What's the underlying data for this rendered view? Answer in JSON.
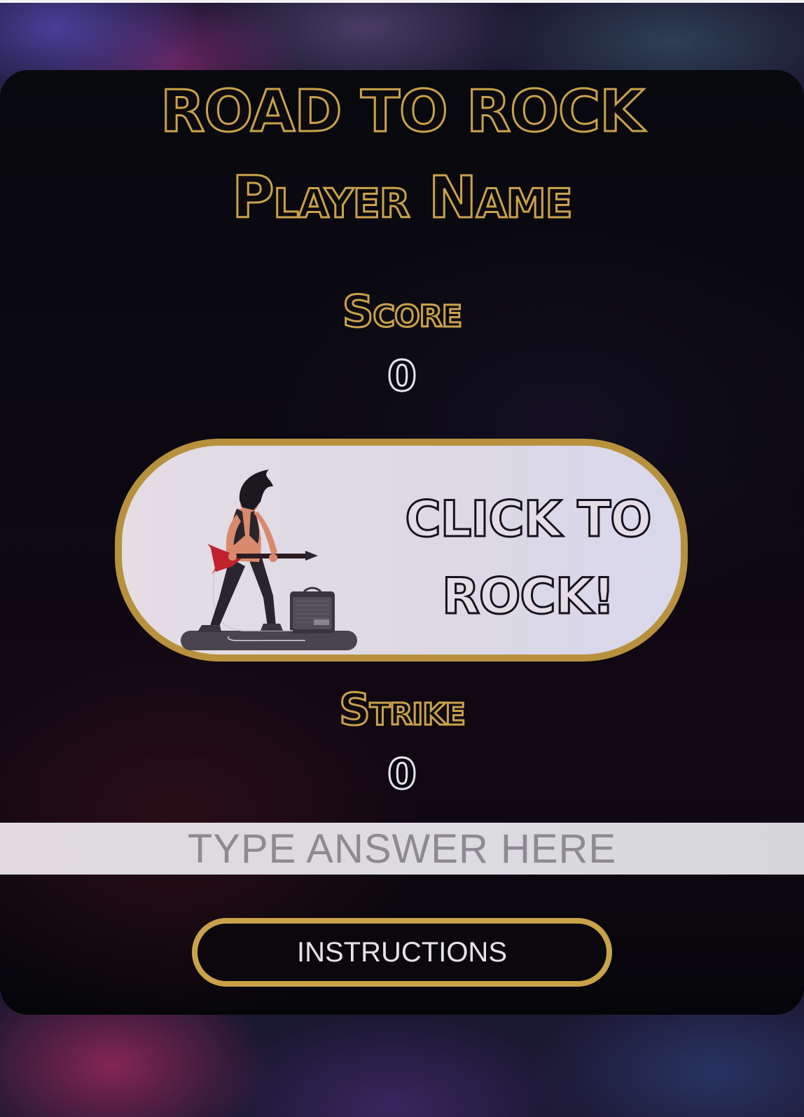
{
  "game": {
    "title": "ROAD TO ROCK",
    "player_name": "Player Name"
  },
  "score": {
    "label": "Score",
    "value": "0"
  },
  "rock_button": {
    "label_line1": "CLICK TO",
    "label_line2": "ROCK!",
    "illustration": "rock-guitarist-illustration"
  },
  "strike": {
    "label": "Strike",
    "value": "0"
  },
  "answer_input": {
    "placeholder": "TYPE ANSWER HERE",
    "value": ""
  },
  "instructions_button": {
    "label": "INSTRUCTIONS"
  },
  "colors": {
    "gold": "#c9a24a",
    "panel": "#0b0910",
    "button_face": "#e1dce6"
  }
}
